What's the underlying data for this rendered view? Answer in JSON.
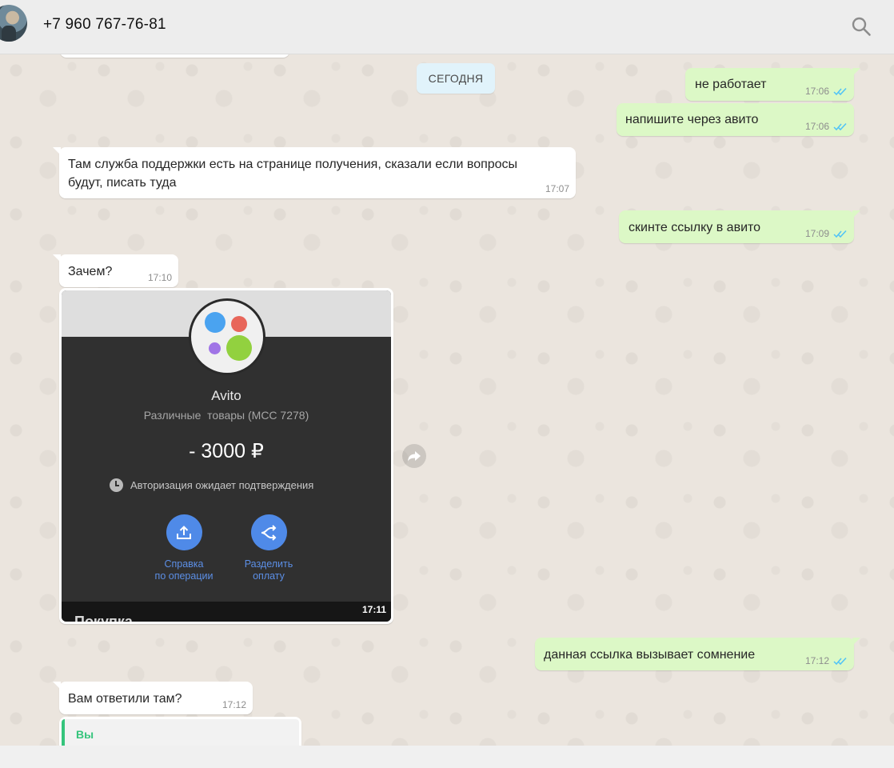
{
  "header": {
    "contact_name": "+7 960 767-76-81",
    "icons": {
      "search": "search-icon",
      "avatar": "avatar"
    }
  },
  "date_divider": "СЕГОДНЯ",
  "messages": [
    {
      "dir": "out",
      "text": "не работает",
      "time": "17:06",
      "status": "read"
    },
    {
      "dir": "out",
      "text": "напишите через авито",
      "time": "17:06",
      "status": "read"
    },
    {
      "dir": "in",
      "text": "Там служба поддержки есть на странице получения, сказали если вопросы будут, писать туда",
      "time": "17:07"
    },
    {
      "dir": "out",
      "text": "скинте ссылку в авито",
      "time": "17:09",
      "status": "read"
    },
    {
      "dir": "in",
      "text": "Зачем?",
      "time": "17:10"
    },
    {
      "dir": "out",
      "text": "данная ссылка вызывает сомнение",
      "time": "17:12",
      "status": "read"
    },
    {
      "dir": "in",
      "text": "Вам ответили там?",
      "time": "17:12"
    }
  ],
  "image_message": {
    "time": "17:11",
    "merchant": "Avito",
    "category": "Различные  товары (MCC 7278)",
    "amount": "- 3000 ₽",
    "status": "Авторизация ожидает подтверждения",
    "actions": [
      {
        "line1": "Справка",
        "line2": "по операции",
        "icon": "upload-icon"
      },
      {
        "line1": "Разделить",
        "line2": "оплату",
        "icon": "split-icon"
      }
    ],
    "bottom_text": "Покупка",
    "logo_colors": [
      "#4aa3f0",
      "#e8665a",
      "#a074e6",
      "#92d13f"
    ]
  },
  "reply_quote": {
    "author": "Вы"
  },
  "colors": {
    "outgoing_bubble": "#dcf8c6",
    "incoming_bubble": "#ffffff",
    "read_ticks": "#4fc3f7",
    "quote_accent": "#35c47c"
  }
}
